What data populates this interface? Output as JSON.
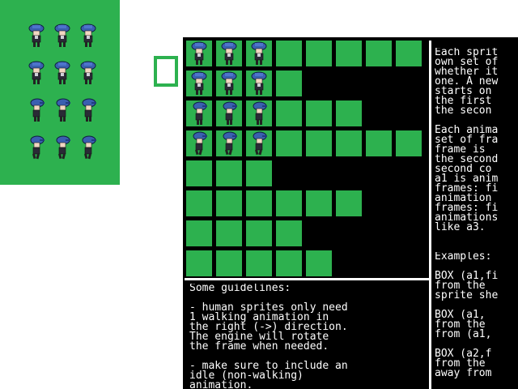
{
  "colors": {
    "green": "#2db14f",
    "black": "#000000",
    "white": "#ffffff"
  },
  "preview": {
    "rows": [
      {
        "pose": "down"
      },
      {
        "pose": "down"
      },
      {
        "pose": "right"
      },
      {
        "pose": "right-walk"
      }
    ]
  },
  "sheet": {
    "row_lengths": [
      8,
      4,
      6,
      8,
      3,
      6,
      4,
      5
    ],
    "sprite_rows": [
      {
        "row": 0,
        "count": 3,
        "pose": "down"
      },
      {
        "row": 1,
        "count": 3,
        "pose": "down"
      },
      {
        "row": 2,
        "count": 3,
        "pose": "right"
      },
      {
        "row": 3,
        "count": 3,
        "pose": "right-walk"
      }
    ]
  },
  "guidelines_text": "Some guidelines:\n\n- human sprites only need\n1 walking animation in\nthe right (->) direction.\nThe engine will rotate\nthe frame when needed.\n\n- make sure to include an\nidle (non-walking)\nanimation.",
  "help_text": "Each sprit\nown set of\nwhether it\none. A new\nstarts on\nthe first\nthe secon\n\nEach anima\nset of fra\nframe is\nthe second\nsecond co\na1 is anim\nframes: fi\nanimation\nframes: fi\nanimations\nlike a3.",
  "examples_text": "Examples:\n\nBOX (a1,fi\nfrom the\nsprite she\n\nBOX (a1,\nfrom the\nfrom (a1,\n\nBOX (a2,f\nfrom the\naway from"
}
